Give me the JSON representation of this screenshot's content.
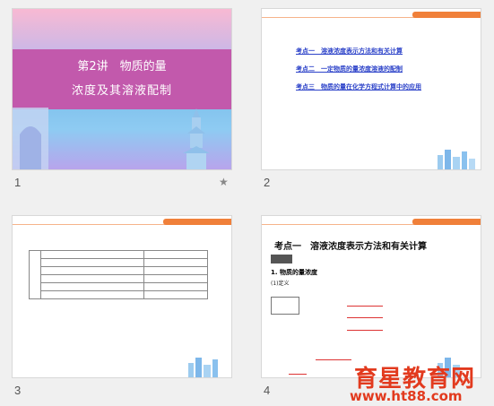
{
  "slides": [
    {
      "number": "1",
      "title_line1": "第2讲　物质的量",
      "title_line2": "浓度及其溶液配制"
    },
    {
      "number": "2",
      "links": [
        "考点一　溶液浓度表示方法和有关计算",
        "考点二　一定物质的量浓度溶液的配制",
        "考点三　物质的量在化学方程式计算中的应用"
      ]
    },
    {
      "number": "3"
    },
    {
      "number": "4",
      "title": "考点一　溶液浓度表示方法和有关计算",
      "section": "1. 物质的量浓度",
      "sub": "(1)定义"
    }
  ],
  "watermark": {
    "line1": "育星教育网",
    "line2": "www.ht88.com"
  },
  "colors": {
    "band": "#c259ac",
    "header": "#f0803a",
    "link": "#2d43c9",
    "watermark": "#e23a1e"
  }
}
